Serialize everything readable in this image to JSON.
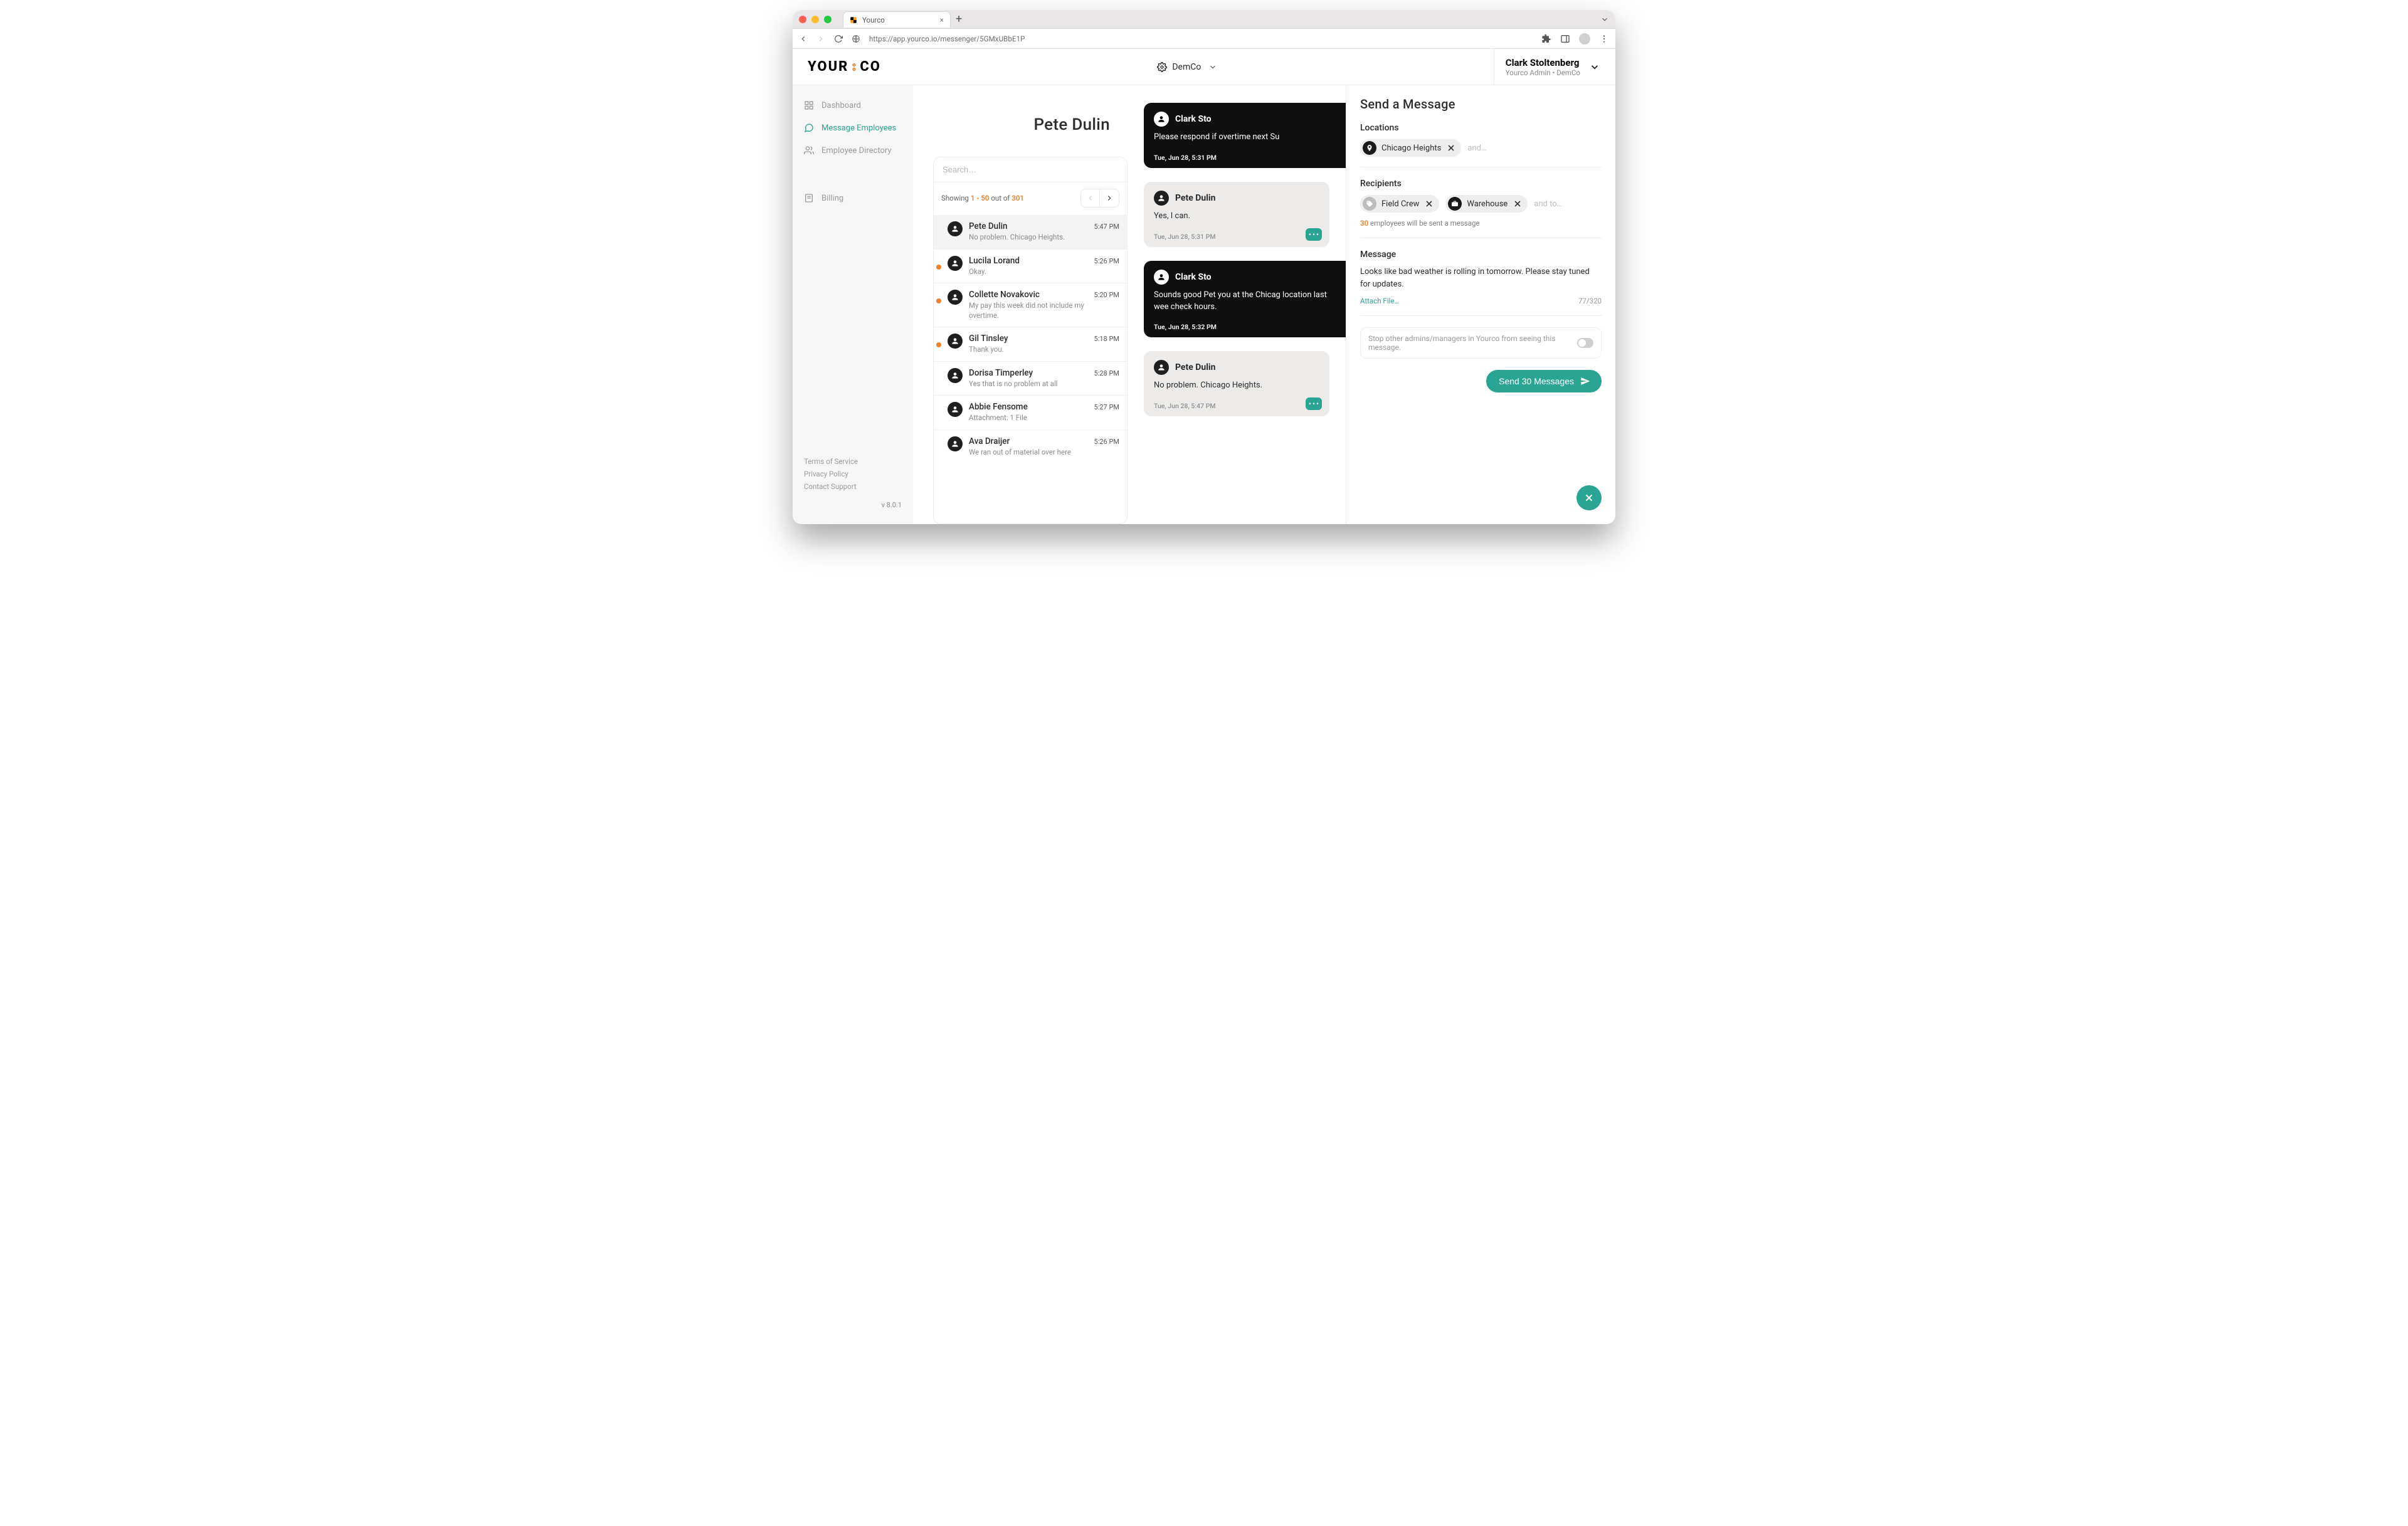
{
  "browser": {
    "tab_title": "Yourco",
    "url": "https://app.yourco.io/messenger/5GMxUBbE1P"
  },
  "brand": {
    "part1": "YOUR",
    "part2": "CO"
  },
  "org_switch": {
    "label": "DemCo"
  },
  "user": {
    "name": "Clark Stoltenberg",
    "sub": "Yourco Admin • DemCo"
  },
  "sidebar": {
    "items": [
      {
        "label": "Dashboard"
      },
      {
        "label": "Message Employees"
      },
      {
        "label": "Employee Directory"
      },
      {
        "label": "Billing"
      }
    ],
    "legal_tos": "Terms of Service",
    "legal_privacy": "Privacy Policy",
    "legal_contact": "Contact Support",
    "version": "v 8.0.1"
  },
  "thread": {
    "title": "Pete Dulin",
    "search_placeholder": "Search…",
    "showing_prefix": "Showing ",
    "showing_range": "1 - 50",
    "showing_mid": " out of ",
    "showing_total": "301",
    "items": [
      {
        "name": "Pete Dulin",
        "preview": "No problem. Chicago Heights.",
        "time": "5:47 PM",
        "active": true,
        "unread": false
      },
      {
        "name": "Lucila Lorand",
        "preview": "Okay.",
        "time": "5:26 PM",
        "unread": true
      },
      {
        "name": "Collette Novakovic",
        "preview": "My pay this week did not include my overtime.",
        "time": "5:20 PM",
        "unread": true
      },
      {
        "name": "Gil Tinsley",
        "preview": "Thank you.",
        "time": "5:18 PM",
        "unread": true
      },
      {
        "name": "Dorisa Timperley",
        "preview": "Yes that is no problem at all",
        "time": "5:28 PM"
      },
      {
        "name": "Abbie Fensome",
        "preview": "Attachment: 1 File",
        "time": "5:27 PM"
      },
      {
        "name": "Ava Draijer",
        "preview": "We ran out of material over here",
        "time": "5:26 PM"
      }
    ]
  },
  "messages": [
    {
      "kind": "dark",
      "author": "Clark Sto",
      "text": "Please respond if overtime next Su",
      "ts": "Tue, Jun 28, 5:31 PM"
    },
    {
      "kind": "light",
      "author": "Pete Dulin",
      "text": "Yes, I can.",
      "ts": "Tue, Jun 28, 5:31 PM"
    },
    {
      "kind": "dark",
      "author": "Clark Sto",
      "text": "Sounds good Pet you at the Chicag location last wee check hours.",
      "ts": "Tue, Jun 28, 5:32 PM"
    },
    {
      "kind": "light",
      "author": "Pete Dulin",
      "text": "No problem. Chicago Heights.",
      "ts": "Tue, Jun 28, 5:47 PM"
    }
  ],
  "panel": {
    "title": "Send a Message",
    "locations_label": "Locations",
    "loc_chip": "Chicago Heights",
    "loc_hint": "and…",
    "recipients_label": "Recipients",
    "recip_chip1": "Field Crew",
    "recip_chip2": "Warehouse",
    "recip_hint": "and to…",
    "recip_count": "30",
    "recip_note_rest": " employees will be sent a message",
    "message_label": "Message",
    "message_body": "Looks like bad weather is rolling in tomorrow. Please stay tuned for updates.",
    "attach_label": "Attach File…",
    "char_counter": "77/320",
    "privacy_text": "Stop other admins/managers in Yourco from seeing this message.",
    "send_label": "Send 30 Messages"
  }
}
